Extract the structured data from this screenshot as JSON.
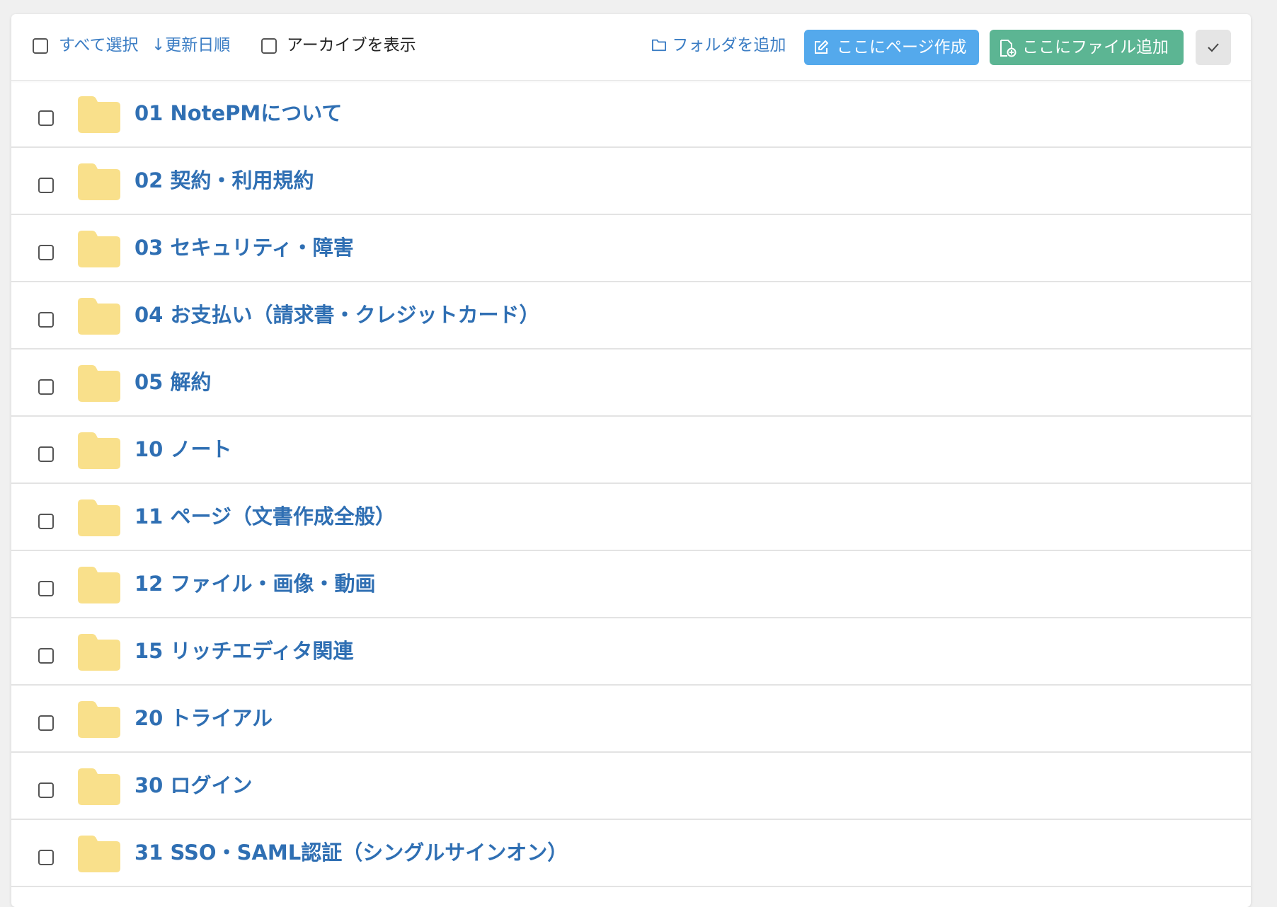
{
  "toolbar": {
    "select_all": "すべて選択",
    "sort": "更新日順",
    "show_archive": "アーカイブを表示",
    "add_folder": "フォルダを追加",
    "create_page": "ここにページ作成",
    "add_file": "ここにファイル追加",
    "icons": {
      "sort": "arrow-down-icon",
      "add_folder": "folder-outline-icon",
      "create_page": "edit-icon",
      "add_file": "file-add-icon",
      "confirm": "check-icon"
    }
  },
  "folders": [
    {
      "name": "01 NotePMについて"
    },
    {
      "name": "02 契約・利用規約"
    },
    {
      "name": "03 セキュリティ・障害"
    },
    {
      "name": "04 お支払い（請求書・クレジットカード）"
    },
    {
      "name": "05 解約"
    },
    {
      "name": "10 ノート"
    },
    {
      "name": "11 ページ（文書作成全般）"
    },
    {
      "name": "12 ファイル・画像・動画"
    },
    {
      "name": "15 リッチエディタ関連"
    },
    {
      "name": "20 トライアル"
    },
    {
      "name": "30 ログイン"
    },
    {
      "name": "31 SSO・SAML認証（シングルサインオン）"
    }
  ],
  "colors": {
    "link": "#3b7dc4",
    "folder_name": "#2f6fb3",
    "folder_icon": "#f9e08b",
    "button_blue": "#54a9ec",
    "button_green": "#5cb593",
    "button_gray": "#e5e5e5"
  }
}
